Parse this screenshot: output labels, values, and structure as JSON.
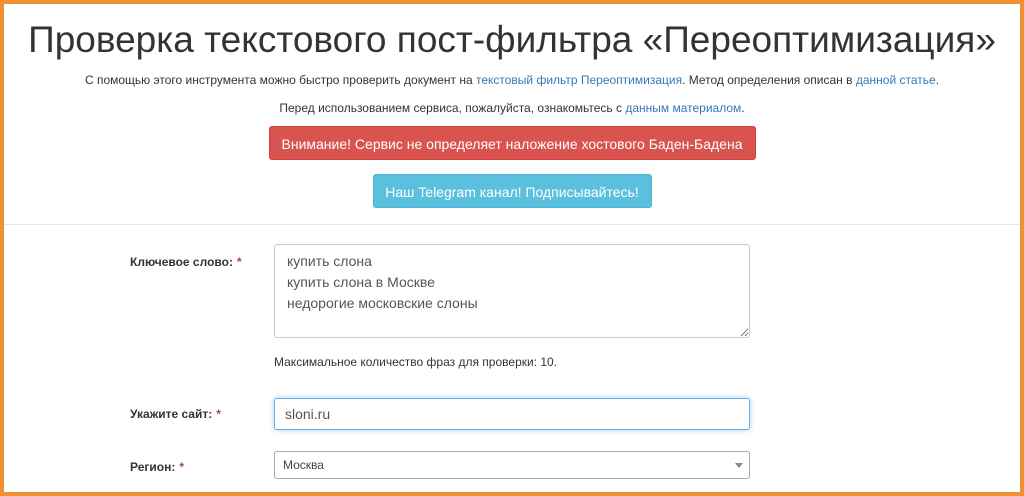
{
  "header": {
    "title": "Проверка текстового пост-фильтра «Переоптимизация»",
    "intro": {
      "prefix": "С помощью этого инструмента можно быстро проверить документ на ",
      "link1": "текстовый фильтр Переоптимизация",
      "middle": ". Метод определения описан в ",
      "link2": "данной статье",
      "suffix": "."
    },
    "note": {
      "prefix": "Перед использованием сервиса, пожалуйста, ознакомьтесь с ",
      "link": "данным материалом",
      "suffix": "."
    },
    "warning_button": "Внимание! Сервис не определяет наложение хостового Баден-Бадена",
    "telegram_button": "Наш Telegram канал! Подписывайтесь!"
  },
  "form": {
    "keyword": {
      "label": "Ключевое слово:",
      "required_mark": "*",
      "value": "купить слона\nкупить слона в Москве\nнедорогие московские слоны",
      "hint": "Максимальное количество фраз для проверки: 10."
    },
    "site": {
      "label": "Укажите сайт:",
      "required_mark": "*",
      "value": "sloni.ru"
    },
    "region": {
      "label": "Регион:",
      "required_mark": "*",
      "selected": "Москва"
    }
  },
  "colors": {
    "border_accent": "#f0922f",
    "danger": "#d9534f",
    "info": "#5bc0de",
    "link": "#337ab7"
  }
}
